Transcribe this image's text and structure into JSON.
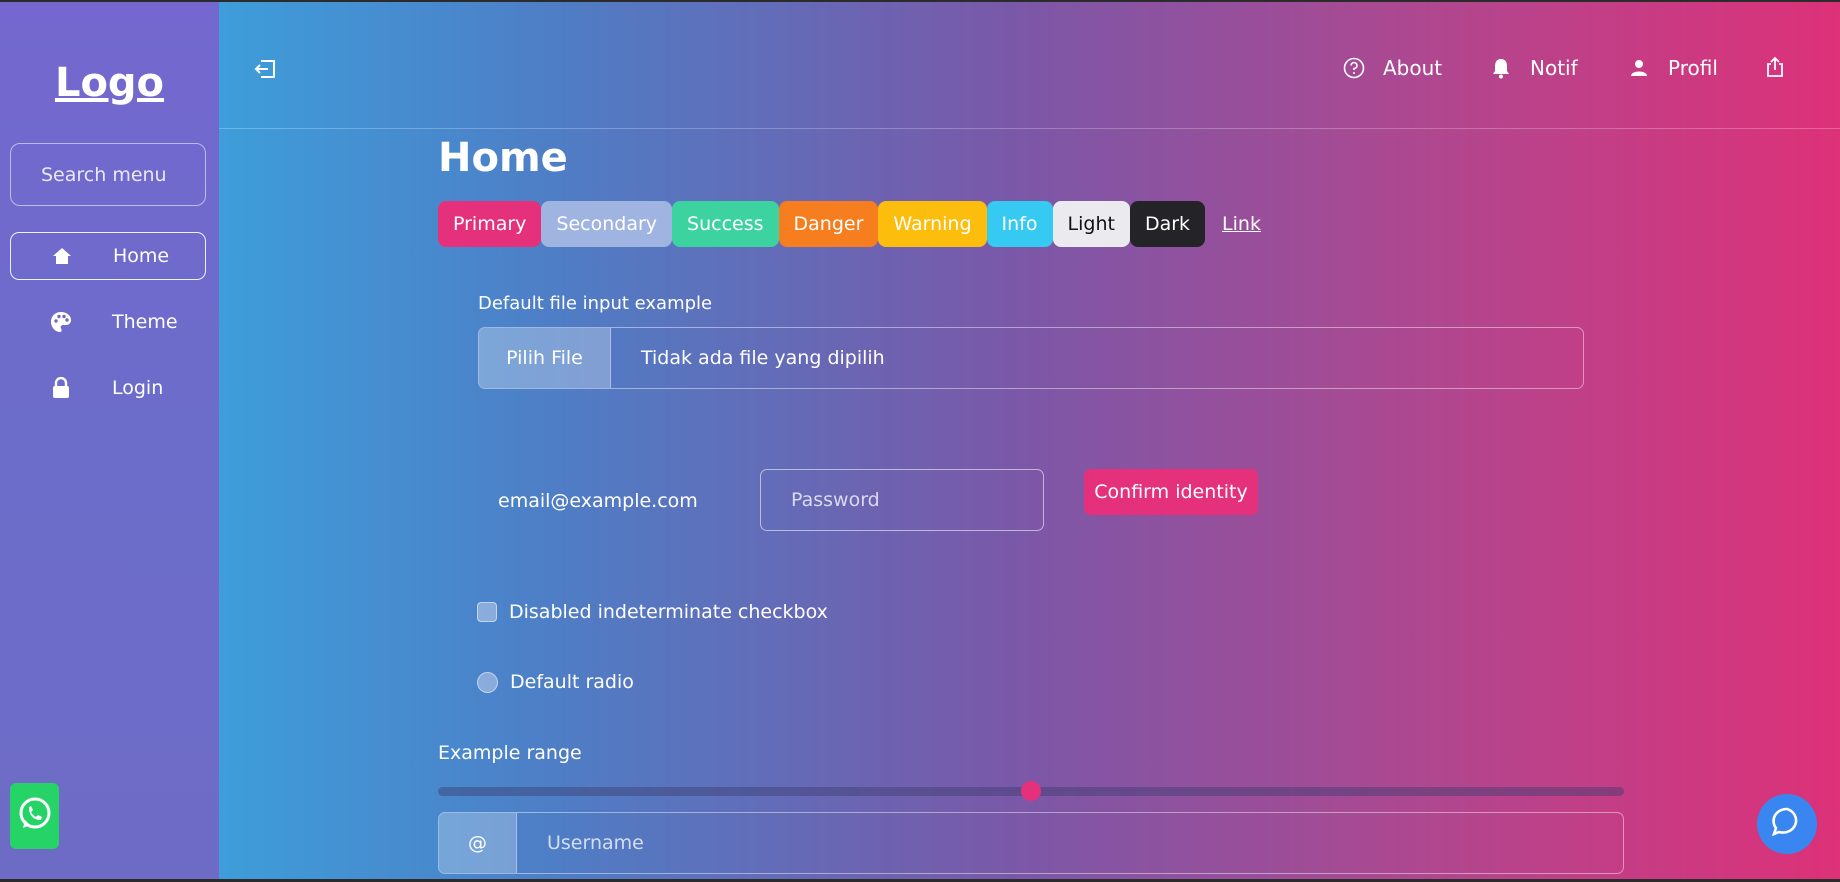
{
  "sidebar": {
    "logo": "Logo",
    "search_placeholder": "Search menu",
    "items": [
      {
        "label": "Home",
        "icon": "home-icon",
        "active": true
      },
      {
        "label": "Theme",
        "icon": "palette-icon",
        "active": false
      },
      {
        "label": "Login",
        "icon": "lock-icon",
        "active": false
      }
    ],
    "whatsapp_icon": "whatsapp-icon"
  },
  "header": {
    "collapse_icon": "sidebar-collapse-icon",
    "items": [
      {
        "label": "About",
        "icon": "question-circle-icon"
      },
      {
        "label": "Notif",
        "icon": "bell-icon"
      },
      {
        "label": "Profil",
        "icon": "person-icon"
      }
    ],
    "share_icon": "share-icon"
  },
  "main": {
    "title": "Home",
    "buttons": [
      {
        "label": "Primary",
        "color": "#e5317c",
        "text_color": "#ffffff"
      },
      {
        "label": "Secondary",
        "color": "#9fb4e0",
        "text_color": "#ffffff"
      },
      {
        "label": "Success",
        "color": "#3dd3a0",
        "text_color": "#ffffff"
      },
      {
        "label": "Danger",
        "color": "#f67e1f",
        "text_color": "#ffffff"
      },
      {
        "label": "Warning",
        "color": "#fdbd0d",
        "text_color": "#ffffff"
      },
      {
        "label": "Info",
        "color": "#36c9f2",
        "text_color": "#ffffff"
      },
      {
        "label": "Light",
        "color": "#ebebef",
        "text_color": "#111111"
      },
      {
        "label": "Dark",
        "color": "#242428",
        "text_color": "#ffffff"
      }
    ],
    "link_label": "Link",
    "file_input": {
      "label": "Default file input example",
      "button_label": "Pilih File",
      "status": "Tidak ada file yang dipilih"
    },
    "email_value": "email@example.com",
    "password_placeholder": "Password",
    "confirm_label": "Confirm identity",
    "checkbox_label": "Disabled indeterminate checkbox",
    "radio_label": "Default radio",
    "range": {
      "label": "Example range",
      "value": 0.5
    },
    "username": {
      "addon": "@",
      "placeholder": "Username"
    }
  },
  "chat_icon": "chat-bubble-icon",
  "colors": {
    "accent": "#e5317c",
    "chat": "#3a86f0",
    "whatsapp": "#25d366"
  }
}
